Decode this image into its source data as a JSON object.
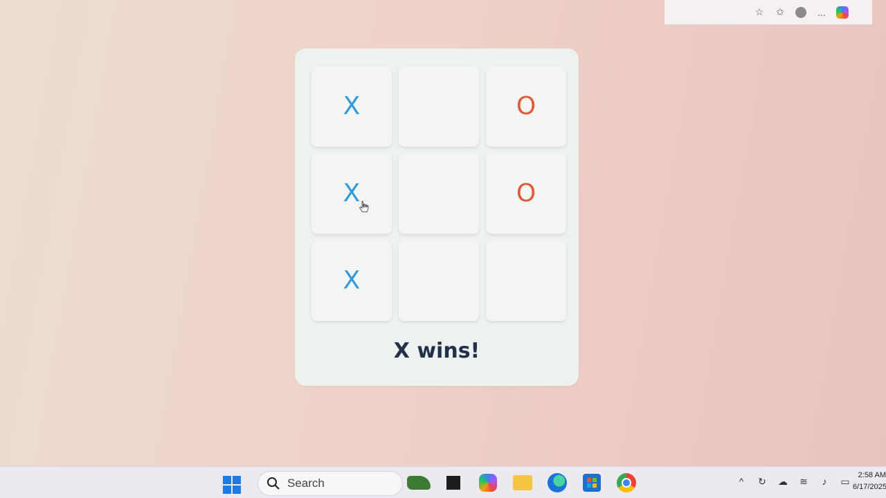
{
  "browser": {
    "icons": [
      "star-icon",
      "favorites-icon",
      "profile-icon",
      "more-icon",
      "copilot-icon"
    ],
    "more_label": "..."
  },
  "game": {
    "board": [
      [
        "X",
        "",
        "O"
      ],
      [
        "X",
        "",
        "O"
      ],
      [
        "X",
        "",
        ""
      ]
    ],
    "status": "X wins!",
    "colors": {
      "x": "#2e9ae0",
      "o": "#e05a3a",
      "status": "#23304a"
    }
  },
  "taskbar": {
    "search_label": "Search",
    "apps": [
      "frog-widget",
      "task-view",
      "copilot",
      "file-explorer",
      "edge",
      "microsoft-store",
      "chrome"
    ],
    "time": "2:58 AM",
    "date": "6/17/2025"
  }
}
